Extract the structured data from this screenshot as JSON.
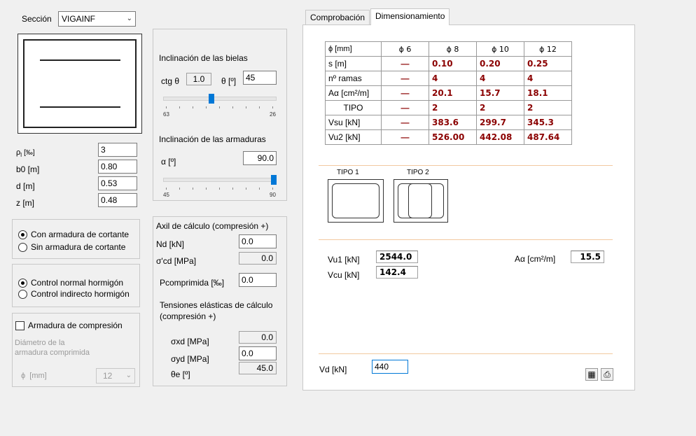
{
  "left": {
    "section_label": "Sección",
    "section_value": "VIGAINF",
    "params": [
      {
        "label": "ρ",
        "sub": "l",
        "unit": "[‰]",
        "value": "3"
      },
      {
        "label": "b0 [m]",
        "value": "0.80"
      },
      {
        "label": "d [m]",
        "value": "0.53"
      },
      {
        "label": "z [m]",
        "value": "0.48"
      }
    ],
    "shear_options": [
      "Con armadura de cortante",
      "Sin armadura de cortante"
    ],
    "control_options": [
      "Control normal hormigón",
      "Control indirecto hormigón"
    ],
    "compression_check": "Armadura de compresión",
    "diam_label_1": "Diámetro de la",
    "diam_label_2": "armadura comprimida",
    "diam_phi": "ϕ",
    "diam_unit": "[mm]",
    "diam_value": "12"
  },
  "middle": {
    "bielas_title": "Inclinación de las bielas",
    "ctg_label": "ctg θ",
    "ctg_value": "1.0",
    "theta_label": "θ [º]",
    "theta_value": "45",
    "slider1_min": "63",
    "slider1_max": "26",
    "slider1_level_pct": 42,
    "armaduras_title": "Inclinación de las armaduras",
    "alpha_label": "α [º]",
    "alpha_value": "90.0",
    "slider2_min": "45",
    "slider2_max": "90",
    "slider2_level_pct": 100,
    "axil_title": "Axil de cálculo (compresión +)",
    "nd_label": "Nd [kN]",
    "nd_value": "0.0",
    "scd_label": "σ'cd [MPa]",
    "scd_value": "0.0",
    "pcomp_label": "Pcomprimida [‰]",
    "pcomp_value": "0.0",
    "tens_title_1": "Tensiones elásticas de cálculo",
    "tens_title_2": "(compresión +)",
    "sxd_label": "σxd [MPa]",
    "sxd_value": "0.0",
    "syd_label": "σyd [MPa]",
    "syd_value": "0.0",
    "thetae_label": "θe [º]",
    "thetae_value": "45.0"
  },
  "tabs": [
    "Comprobación",
    "Dimensionamiento"
  ],
  "table": {
    "header": [
      "ϕ [mm]",
      "ϕ 6",
      "ϕ 8",
      "ϕ 10",
      "ϕ 12"
    ],
    "rows": [
      {
        "label": "s [m]",
        "values": [
          "—",
          "0.10",
          "0.20",
          "0.25"
        ]
      },
      {
        "label": "nº ramas",
        "values": [
          "—",
          "4",
          "4",
          "4"
        ]
      },
      {
        "label": "Aα [cm²/m]",
        "values": [
          "—",
          "20.1",
          "15.7",
          "18.1"
        ]
      },
      {
        "label": "TIPO",
        "values": [
          "—",
          "2",
          "2",
          "2"
        ]
      },
      {
        "label": "Vsu [kN]",
        "values": [
          "—",
          "383.6",
          "299.7",
          "345.3"
        ]
      },
      {
        "label": "Vu2 [kN]",
        "values": [
          "—",
          "526.00",
          "442.08",
          "487.64"
        ]
      }
    ]
  },
  "tipos": [
    "TIPO 1",
    "TIPO 2"
  ],
  "results": {
    "vu1_label": "Vu1 [kN]",
    "vu1_value": "2544.0",
    "vcu_label": "Vcu [kN]",
    "vcu_value": "142.4",
    "aalpha_label": "Aα [cm²/m]",
    "aalpha_value": "15.5",
    "vd_label": "Vd [kN]",
    "vd_value": "440"
  }
}
